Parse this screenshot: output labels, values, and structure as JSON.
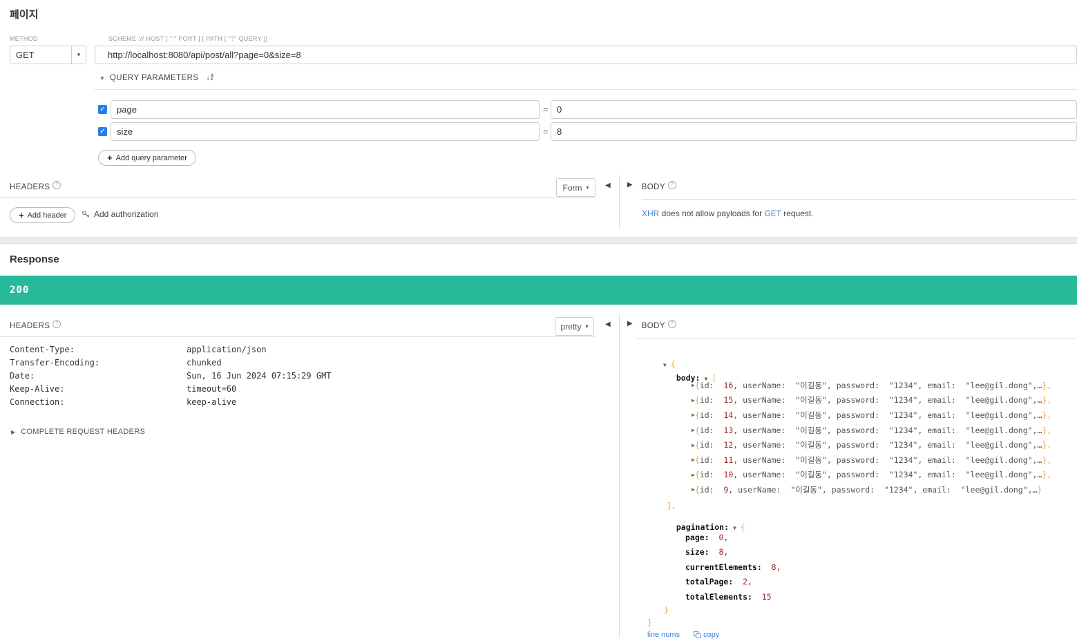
{
  "request": {
    "title": "페이지",
    "method_label": "METHOD",
    "method_value": "GET",
    "scheme_label": "SCHEME :// HOST [ \":\" PORT ] [ PATH [ \"?\" QUERY ]]",
    "url": "http://localhost:8080/api/post/all?page=0&size=8",
    "query_section_label": "QUERY PARAMETERS",
    "equals": "=",
    "params": [
      {
        "name": "page",
        "value": "0",
        "checked": true
      },
      {
        "name": "size",
        "value": "8",
        "checked": true
      }
    ],
    "add_param_label": "Add query parameter",
    "headers_label": "HEADERS",
    "add_header_label": "Add header",
    "add_auth_label": "Add authorization",
    "form_dropdown": "Form",
    "body_label": "BODY",
    "body_message_parts": [
      {
        "text": "XHR",
        "link": true
      },
      {
        "text": " does not allow payloads for ",
        "link": false
      },
      {
        "text": "GET",
        "link": true
      },
      {
        "text": " request.",
        "link": false
      }
    ]
  },
  "response": {
    "title": "Response",
    "status_code": "200",
    "headers_label": "HEADERS",
    "view_dropdown": "pretty",
    "body_label": "BODY",
    "headers": [
      {
        "name": "Content-Type:",
        "value": "application/json"
      },
      {
        "name": "Transfer-Encoding:",
        "value": "chunked"
      },
      {
        "name": "Date:",
        "value": "Sun, 16 Jun 2024 07:15:29 GMT"
      },
      {
        "name": "Keep-Alive:",
        "value": "timeout=60"
      },
      {
        "name": "Connection:",
        "value": "keep-alive"
      }
    ],
    "complete_request_headers_label": "COMPLETE REQUEST HEADERS",
    "tree": {
      "root_open": "{",
      "body_key": "body:",
      "array_open": "[",
      "array_close": "],",
      "row_ids": [
        "16",
        "15",
        "14",
        "13",
        "12",
        "11",
        "10",
        "9"
      ],
      "row": {
        "open": "{",
        "id_label": "id:  ",
        "after_id": ", userName:  ",
        "userName": "\"이길동\"",
        "after_userName": ", password:  ",
        "password": "\"1234\"",
        "after_password": ", email:  ",
        "email": "\"lee@gil.dong\"",
        "ellipsis": ",…",
        "close_comma": "},",
        "close": "}"
      },
      "pagination_key": "pagination:",
      "pagination_open": "{",
      "sep": "  ",
      "pagination_entries": [
        {
          "key": "page:",
          "value": "0",
          "comma": ","
        },
        {
          "key": "size:",
          "value": "8",
          "comma": ","
        },
        {
          "key": "currentElements:",
          "value": "8",
          "comma": ","
        },
        {
          "key": "totalPage:",
          "value": "2",
          "comma": ","
        },
        {
          "key": "totalElements:",
          "value": "15",
          "comma": ""
        }
      ],
      "pagination_close": "}",
      "root_close": "}"
    },
    "footer_links": [
      {
        "label": "line nums",
        "icon": false
      },
      {
        "label": "copy",
        "icon": true
      }
    ]
  },
  "icons": {
    "check": "✓",
    "caret_down": "▾",
    "tri_down": "▼",
    "tri_right": "▶",
    "tri_left": "◀",
    "plus": "+",
    "help": "?",
    "sort_arrow": "↓",
    "sort_a": "A",
    "sort_z": "Z"
  },
  "colors": {
    "status_ok": "#26b99a",
    "checkbox_blue": "#2680eb",
    "link_blue": "#3d85d8",
    "brace_orange": "#f2a33c",
    "number_maroon": "#9c2424"
  }
}
